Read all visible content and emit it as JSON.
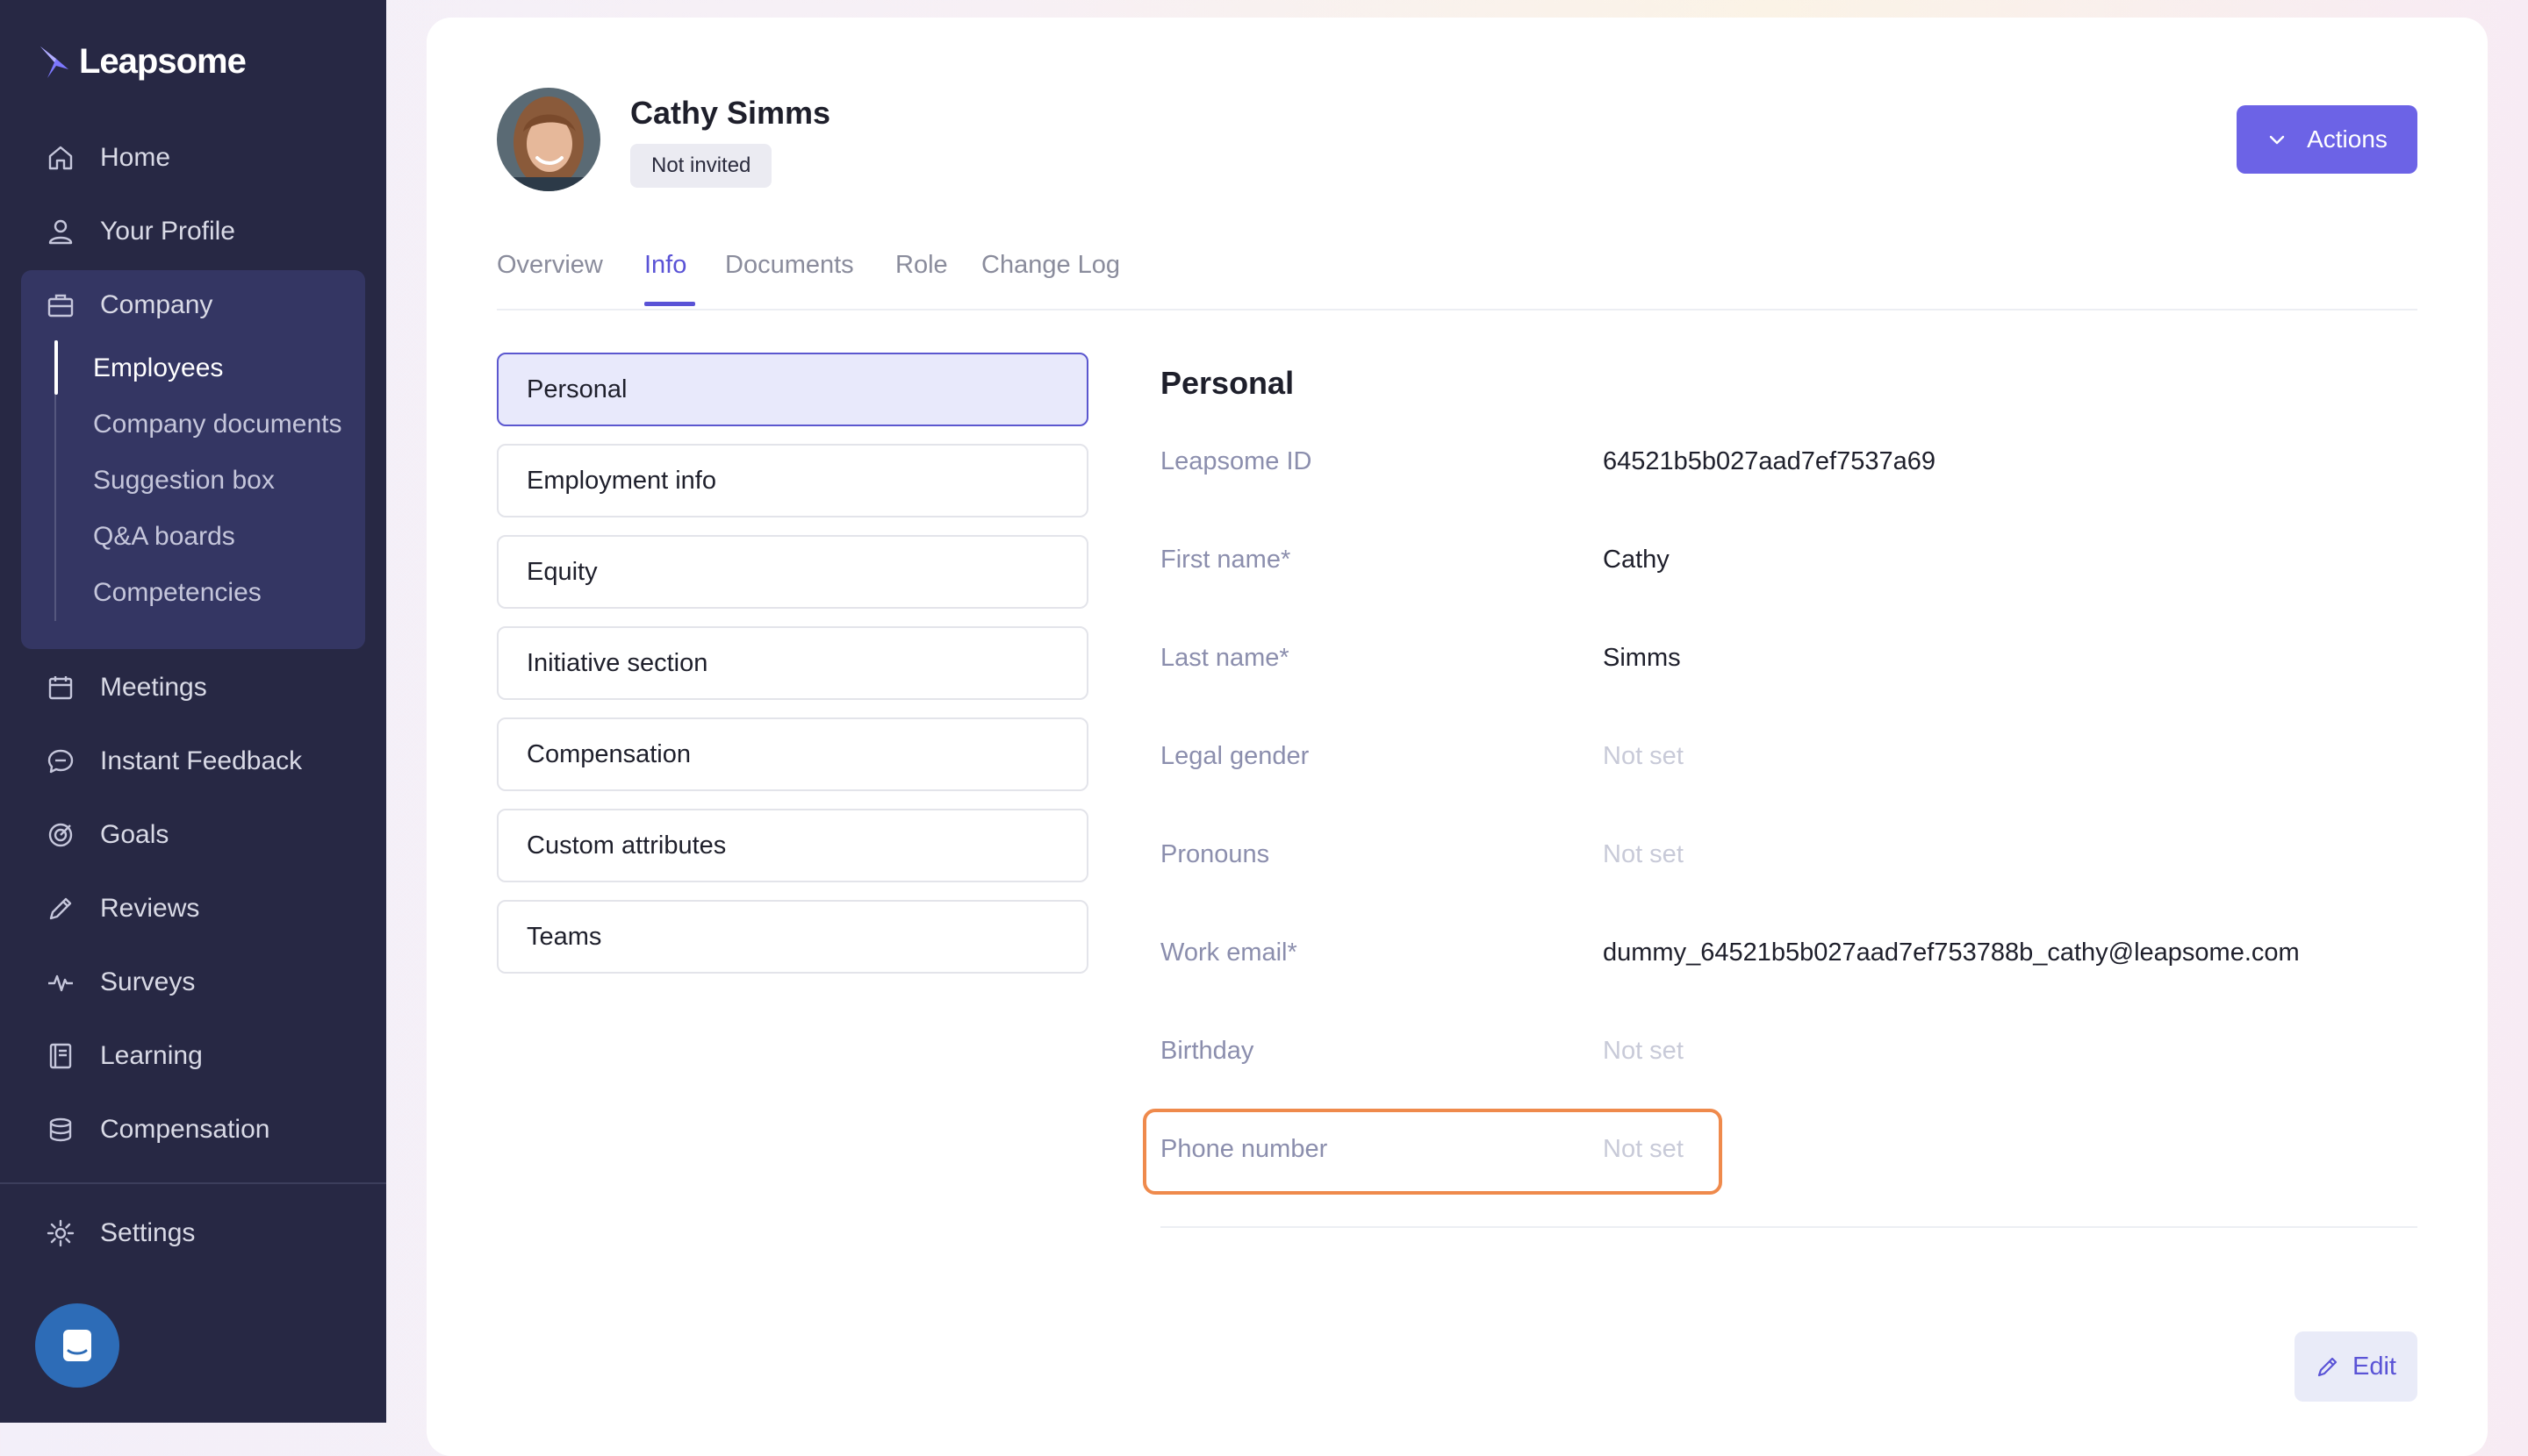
{
  "app": {
    "brand": "Leapsome"
  },
  "sidebar": {
    "items": [
      {
        "label": "Home",
        "icon": "home-icon"
      },
      {
        "label": "Your Profile",
        "icon": "user-icon"
      },
      {
        "label": "Company",
        "icon": "briefcase-icon"
      },
      {
        "label": "Meetings",
        "icon": "calendar-icon"
      },
      {
        "label": "Instant Feedback",
        "icon": "chat-bubble-icon"
      },
      {
        "label": "Goals",
        "icon": "target-icon"
      },
      {
        "label": "Reviews",
        "icon": "pencil-icon"
      },
      {
        "label": "Surveys",
        "icon": "pulse-icon"
      },
      {
        "label": "Learning",
        "icon": "book-icon"
      },
      {
        "label": "Compensation",
        "icon": "coins-icon"
      },
      {
        "label": "Settings",
        "icon": "gear-icon"
      }
    ],
    "company_sub": [
      {
        "label": "Employees",
        "active": true
      },
      {
        "label": "Company documents"
      },
      {
        "label": "Suggestion box"
      },
      {
        "label": "Q&A boards"
      },
      {
        "label": "Competencies"
      }
    ]
  },
  "employee": {
    "name": "Cathy Simms",
    "status": "Not invited"
  },
  "header": {
    "actions_label": "Actions"
  },
  "tabs": [
    {
      "label": "Overview"
    },
    {
      "label": "Info",
      "active": true
    },
    {
      "label": "Documents"
    },
    {
      "label": "Role"
    },
    {
      "label": "Change Log"
    }
  ],
  "sections": [
    {
      "label": "Personal",
      "active": true
    },
    {
      "label": "Employment info"
    },
    {
      "label": "Equity"
    },
    {
      "label": "Initiative section"
    },
    {
      "label": "Compensation"
    },
    {
      "label": "Custom attributes"
    },
    {
      "label": "Teams"
    }
  ],
  "detail": {
    "title": "Personal",
    "fields": [
      {
        "label": "Leapsome ID",
        "value": "64521b5b027aad7ef7537a69"
      },
      {
        "label": "First name*",
        "value": "Cathy"
      },
      {
        "label": "Last name*",
        "value": "Simms"
      },
      {
        "label": "Legal gender",
        "value": "Not set"
      },
      {
        "label": "Pronouns",
        "value": "Not set"
      },
      {
        "label": "Work email*",
        "value": "dummy_64521b5b027aad7ef753788b_cathy@leapsome.com"
      },
      {
        "label": "Birthday",
        "value": "Not set"
      },
      {
        "label": "Phone number",
        "value": "Not set"
      }
    ]
  },
  "footer": {
    "edit_label": "Edit"
  },
  "colors": {
    "sidebar": "#272844",
    "accent": "#6c63e6",
    "highlight": "#ef8a4c"
  }
}
